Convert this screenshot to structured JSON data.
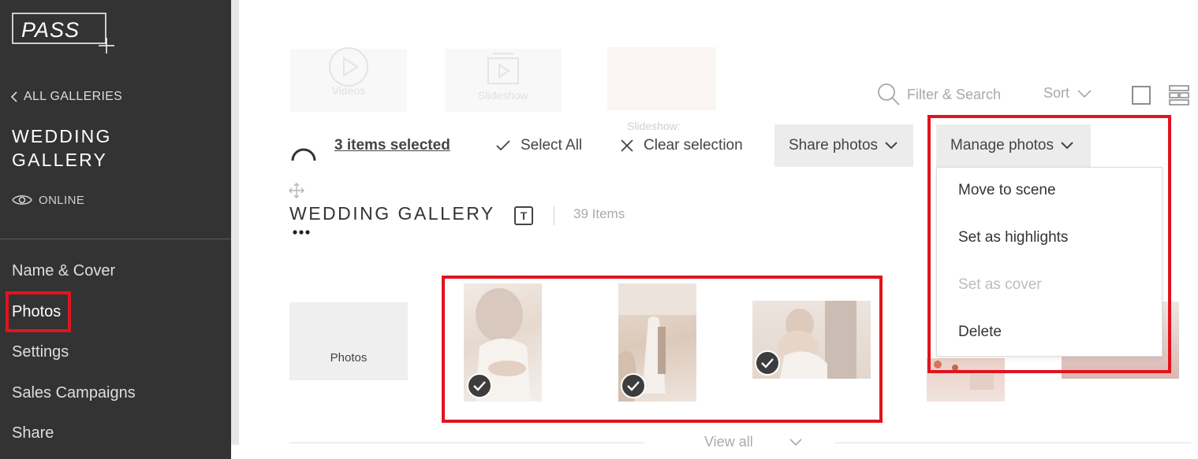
{
  "sidebar": {
    "logo_text": "PASS",
    "back_label": "ALL GALLERIES",
    "gallery_title": "WEDDING GALLERY",
    "status": "ONLINE",
    "nav": [
      {
        "label": "Name & Cover"
      },
      {
        "label": "Photos"
      },
      {
        "label": "Settings"
      },
      {
        "label": "Sales Campaigns"
      },
      {
        "label": "Share"
      }
    ]
  },
  "media_tiles": {
    "videos": "Videos",
    "slideshow": "Slideshow",
    "slideshow_title": "Slideshow:"
  },
  "toolbar": {
    "search_placeholder": "Filter & Search",
    "sort_label": "Sort",
    "selected_count": "3 items selected",
    "select_all": "Select All",
    "clear_selection": "Clear selection",
    "share_photos": "Share photos",
    "manage_photos": "Manage photos"
  },
  "manage_menu": {
    "items": [
      {
        "label": "Move to scene",
        "enabled": true
      },
      {
        "label": "Set as highlights",
        "enabled": true
      },
      {
        "label": "Set as cover",
        "enabled": false
      },
      {
        "label": "Delete",
        "enabled": true
      }
    ]
  },
  "scene": {
    "title": "WEDDING GALLERY",
    "text_icon": "T",
    "item_count": "39 Items",
    "photos_tile_label": "Photos",
    "view_all": "View all"
  },
  "colors": {
    "sidebar_bg": "#333333",
    "highlight_red": "#e0141e",
    "button_bg": "#ececec",
    "check_bg": "#3d3d3d"
  }
}
